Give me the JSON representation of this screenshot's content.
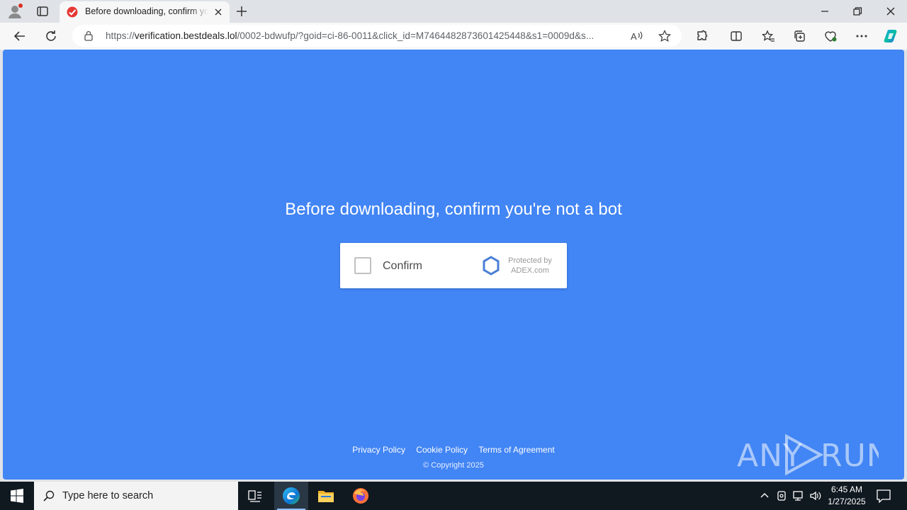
{
  "browser": {
    "tab": {
      "title": "Before downloading, confirm you're not a bot"
    },
    "address": {
      "scheme": "https://",
      "host": "verification.bestdeals.lol",
      "path": "/0002-bdwufp/?goid=ci-86-0011&click_id=M7464482873601425448&s1=0009d&s..."
    }
  },
  "page": {
    "heading": "Before downloading, confirm you're not a bot",
    "captcha": {
      "checkbox_label": "Confirm",
      "protected_line1": "Protected by",
      "protected_line2": "ADEX.com"
    },
    "footer": {
      "links": [
        "Privacy Policy",
        "Cookie Policy",
        "Terms of Agreement"
      ],
      "copyright": "© Copyright 2025"
    },
    "watermark": "ANY RUN"
  },
  "taskbar": {
    "search_placeholder": "Type here to search",
    "time": "6:45 AM",
    "date": "1/27/2025"
  },
  "colors": {
    "page_background": "#4285f4",
    "captcha_logo": "#4a7fd6",
    "taskbar": "#101820"
  }
}
